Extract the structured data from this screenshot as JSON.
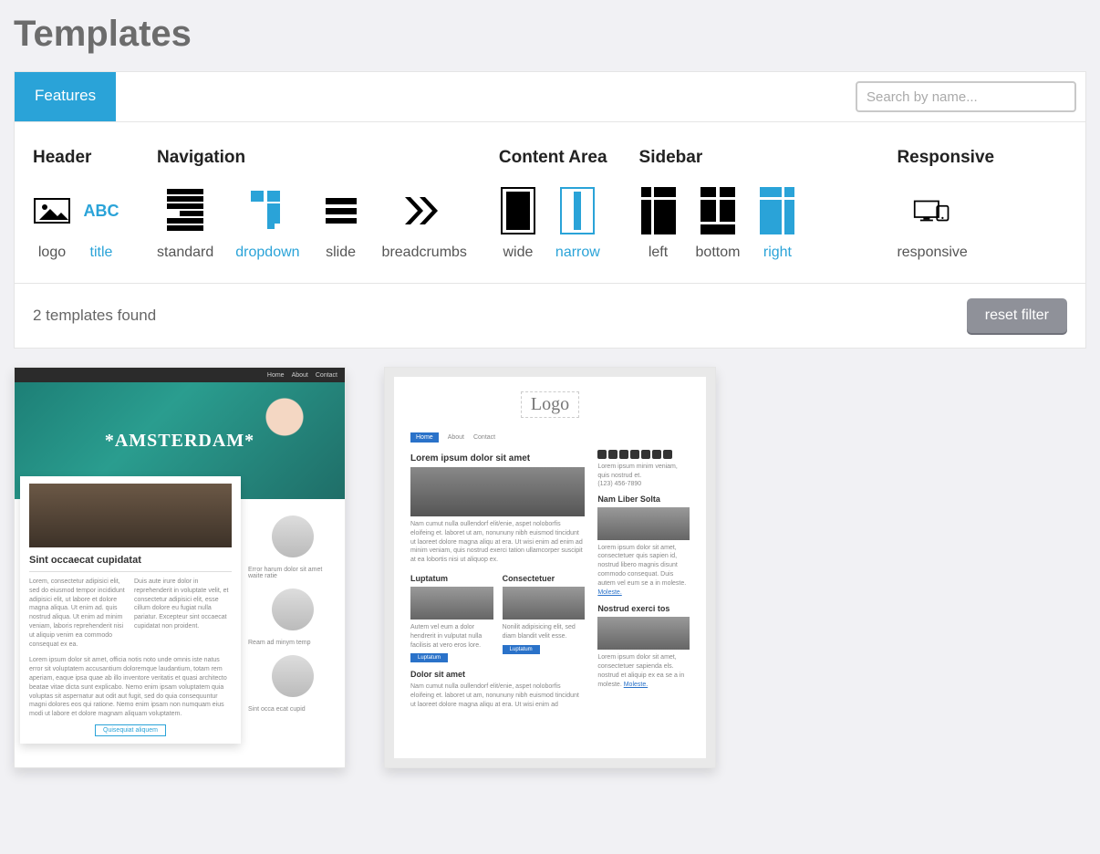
{
  "page": {
    "title": "Templates"
  },
  "tabs": {
    "features": "Features"
  },
  "search": {
    "placeholder": "Search by name..."
  },
  "filters": {
    "header": {
      "title": "Header",
      "logo": "logo",
      "titleOpt": "title"
    },
    "navigation": {
      "title": "Navigation",
      "standard": "standard",
      "dropdown": "dropdown",
      "slide": "slide",
      "breadcrumbs": "breadcrumbs"
    },
    "content": {
      "title": "Content Area",
      "wide": "wide",
      "narrow": "narrow"
    },
    "sidebar": {
      "title": "Sidebar",
      "left": "left",
      "bottom": "bottom",
      "right": "right"
    },
    "responsive": {
      "title": "Responsive",
      "responsive": "responsive"
    }
  },
  "results": {
    "countText": "2 templates found",
    "resetLabel": "reset filter"
  },
  "tpl1": {
    "nav": {
      "home": "Home",
      "about": "About",
      "contact": "Contact"
    },
    "heroTitle": "*AMSTERDAM*",
    "headline": "Sint occaecat cupidatat",
    "p1": "Lorem, consectetur adipisici elit, sed do eiusmod tempor incididunt adipisici elit, ut labore et dolore magna aliqua. Ut enim ad. quis nostrud aliqua. Ut enim ad minim veniam, laboris reprehenderit nisi ut aliquip venim ea commodo consequat ex ea.",
    "p1b": "Duis aute irure dolor in reprehenderit in voluptate velit, et consectetur adipisici elit, esse cillum dolore eu fugiat nulla pariatur. Excepteur sint occaecat cupidatat non proident.",
    "p2": "Lorem ipsum dolor sit amet, officia notis noto unde omnis iste natus error sit voluptatem accusantium doloremque laudantium, totam rem aperiam, eaque ipsa quae ab illo inventore veritatis et quasi architecto beatae vitae dicta sunt explicabo. Nemo enim ipsam voluptatem quia voluptas sit aspernatur aut odit aut fugit, sed do quia consequuntur magni dolores eos qui ratione. Nemo enim ipsam non numquam eius modi ut labore et dolore magnam aliquam voluptatem.",
    "sideA": "Error harum dolor sit amet waite ratie",
    "sideB": "Ream ad minym temp",
    "sideC": "Sint occa ecat cupid",
    "btn": "Quisequiat aliquem"
  },
  "tpl2": {
    "logo": "Logo",
    "nav": {
      "home": "Home",
      "about": "About",
      "contact": "Contact"
    },
    "h1": "Lorem ipsum dolor sit amet",
    "p1": "Nam cumut nulla oullendorf elit/enie, aspet noloborfis eloifeing et. laboret ut am, nonununy nibh euismod tincidunt ut laoreet dolore magna aliqu at era. Ut wisi enim ad enim ad minim veniam, quis nostrud exerci tation ullamcorper suscipit at ea lobortis nisi ut aliquop ex.",
    "sub1": "Luptatum",
    "sub2": "Consectetuer",
    "subp1": "Autem vel eum a dolor hendrerit in vulputat nulla facilisis at vero eros lore.",
    "subp2": "Nonilit adipisicing elit, sed diam blandit velit esse.",
    "btn": "Luptatum",
    "h2": "Dolor sit amet",
    "p2": "Nam cumut nulla oullendorf elit/enie, aspet noloborfis eloifeing et. laboret ut am, nonununy nibh euismod tincidunt ut laoreet dolore magna aliqu at era. Ut wisi enim ad",
    "sideTop": "Lorem ipsum minim veniam, quis nostrud et.",
    "phone": "(123) 456-7890",
    "sh1": "Nam Liber Solta",
    "sp1": "Lorem ipsum dolor sit amet, consectetuer quis sapien id, nostrud libero magnis disunt commodo consequat. Duis autem vel eum se a in moleste. ",
    "sh2": "Nostrud exerci tos",
    "sp2": "Lorem ipsum dolor sit amet, consectetuer sapienda els. nostrud et aliquip ex ea se a in moleste. ",
    "link": "Moleste."
  }
}
